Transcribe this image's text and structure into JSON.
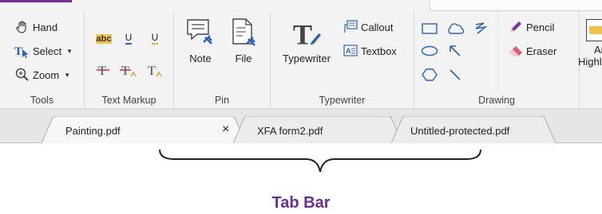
{
  "ribbon": {
    "groups": {
      "tools": {
        "label": "Tools",
        "hand": "Hand",
        "select": "Select",
        "zoom": "Zoom"
      },
      "text_markup": {
        "label": "Text Markup",
        "highlight_text": "abc",
        "underline_1": "U",
        "underline_2": "U"
      },
      "pin": {
        "label": "Pin",
        "note": "Note",
        "file": "File"
      },
      "typewriter": {
        "label": "Typewriter",
        "typewriter": "Typewriter",
        "callout": "Callout",
        "textbox": "Textbox"
      },
      "drawing": {
        "label": "Drawing",
        "pencil": "Pencil",
        "eraser": "Eraser"
      },
      "area_highlight": {
        "line1": "Are",
        "line2": "Highl"
      }
    }
  },
  "tabs": [
    {
      "label": "Painting.pdf",
      "active": true,
      "close": "×"
    },
    {
      "label": "XFA form2.pdf",
      "active": false
    },
    {
      "label": "Untitled-protected.pdf",
      "active": false
    }
  ],
  "annotation": {
    "caption": "Tab Bar"
  },
  "colors": {
    "accent": "#7b2b8f",
    "caption": "#6b2e8e",
    "icon_blue": "#2a63b8",
    "highlight_yellow": "#f2c14e",
    "eraser_pink": "#e05a74",
    "pencil_purple": "#7d3aa8"
  }
}
